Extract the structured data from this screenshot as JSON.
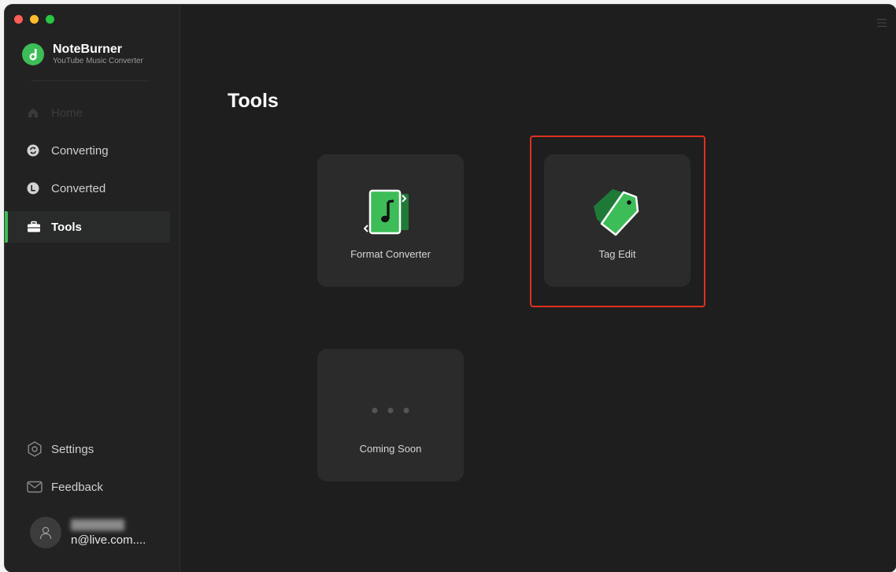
{
  "app": {
    "name": "NoteBurner",
    "subtitle": "YouTube Music Converter"
  },
  "sidebar": {
    "items": [
      {
        "label": "Home",
        "icon": "home-icon"
      },
      {
        "label": "Converting",
        "icon": "converting-icon"
      },
      {
        "label": "Converted",
        "icon": "clock-icon"
      },
      {
        "label": "Tools",
        "icon": "toolbox-icon"
      }
    ],
    "active_item": "Tools",
    "settings_label": "Settings",
    "feedback_label": "Feedback",
    "user_email": "n@live.com...."
  },
  "main": {
    "title": "Tools",
    "tools": [
      {
        "label": "Format Converter",
        "icon": "format-converter-icon"
      },
      {
        "label": "Tag Edit",
        "icon": "tag-icon"
      },
      {
        "label": "Coming Soon",
        "icon": "ellipsis-icon"
      }
    ]
  },
  "colors": {
    "accent": "#3dbd57",
    "highlight": "#e0301e",
    "background": "#1e1e1e",
    "sidebar": "#222222",
    "card": "#2b2b2b"
  }
}
